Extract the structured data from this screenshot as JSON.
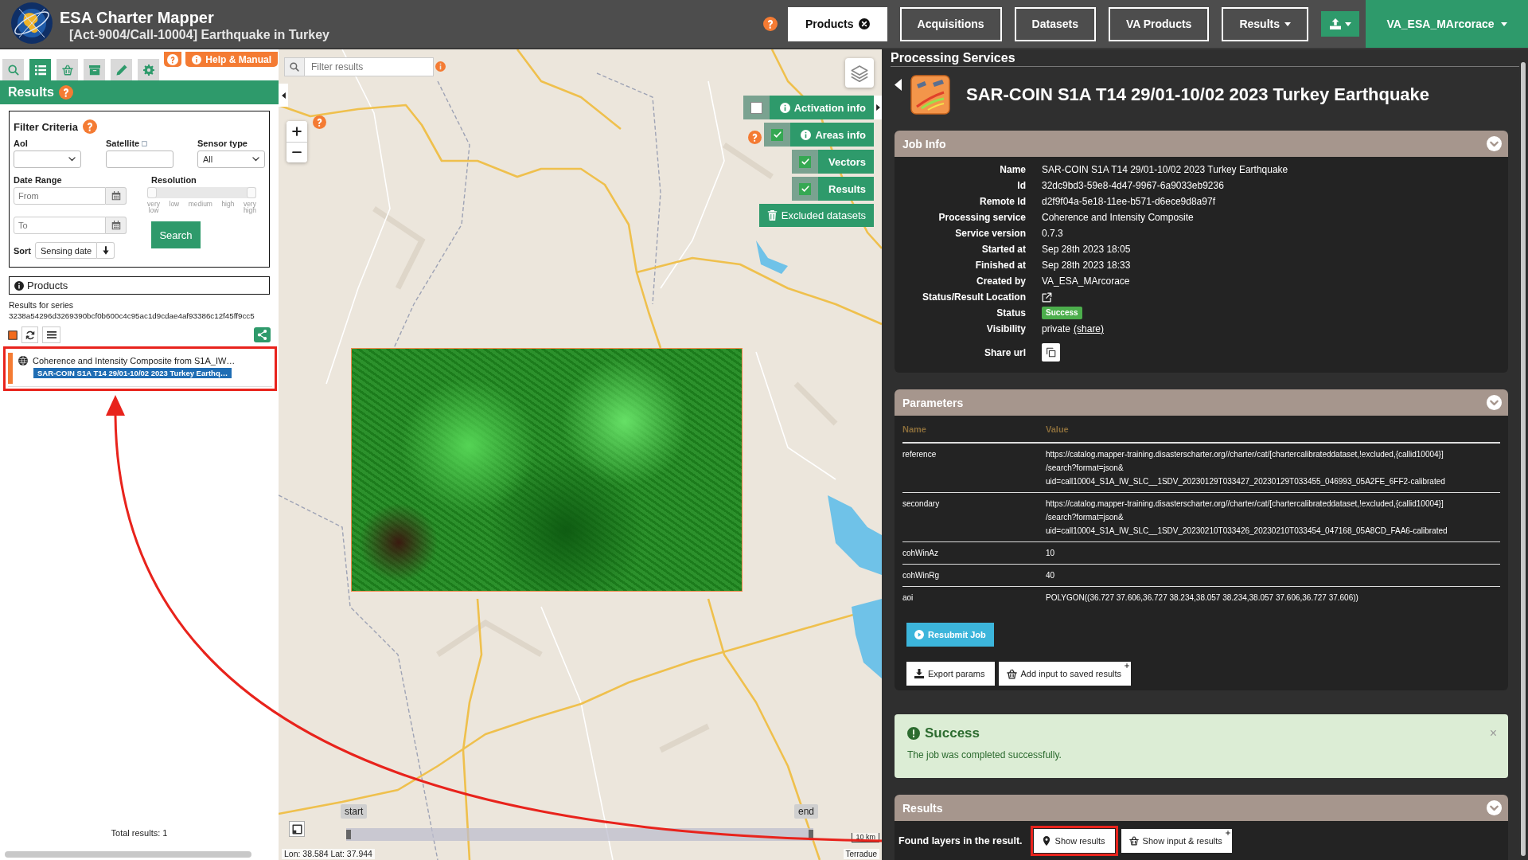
{
  "header": {
    "title": "ESA Charter Mapper",
    "subtitle": "[Act-9004/Call-10004] Earthquake in Turkey",
    "nav": [
      {
        "label": "Products",
        "kind": "closable",
        "selected": true
      },
      {
        "label": "Acquisitions",
        "kind": "plain",
        "selected": false
      },
      {
        "label": "Datasets",
        "kind": "plain",
        "selected": false
      },
      {
        "label": "VA Products",
        "kind": "plain",
        "selected": false
      },
      {
        "label": "Results",
        "kind": "dropdown",
        "selected": false
      }
    ],
    "user": "VA_ESA_MArcorace"
  },
  "sidebar": {
    "tabs": [
      {
        "kind": "search",
        "selected": false
      },
      {
        "kind": "list",
        "selected": true
      },
      {
        "kind": "basket",
        "selected": false
      },
      {
        "kind": "archive",
        "selected": false
      },
      {
        "kind": "pencil",
        "selected": false
      },
      {
        "kind": "gear",
        "selected": false
      }
    ],
    "help_button": "Help & Manual",
    "title": "Results",
    "filter": {
      "title": "Filter Criteria",
      "aoi": {
        "label": "AoI"
      },
      "satellite": {
        "label": "Satellite"
      },
      "sensor_type": {
        "label": "Sensor type",
        "value": "All"
      },
      "date_range": {
        "label": "Date Range",
        "from": {
          "placeholder": "From"
        },
        "to": {
          "placeholder": "To"
        }
      },
      "resolution": {
        "label": "Resolution",
        "level": 1,
        "ticks": [
          "very low",
          "low",
          "medium",
          "high",
          "very high"
        ]
      },
      "search_button": "Search",
      "sort": {
        "label": "Sort",
        "value": "Sensing date"
      }
    },
    "products_title": "Products",
    "series_label": "Results for series",
    "series_id": "3238a54296d3269390bcf0b600c4c95ac1d9cdae4af93386c12f45ff9cc5",
    "results": [
      {
        "title": "Coherence and Intensity Composite from S1A_IW…",
        "tag": "SAR-COIN S1A T14 29/01-10/02 2023 Turkey Earthq…",
        "highlighted": true
      }
    ],
    "total": "Total results: 1"
  },
  "map": {
    "filter": {
      "placeholder": "Filter results"
    },
    "layers": [
      {
        "label": "Activation info",
        "kind": "info",
        "checked": false
      },
      {
        "label": "Areas info",
        "kind": "info",
        "checked": true
      },
      {
        "label": "Vectors",
        "kind": "plain",
        "checked": true
      },
      {
        "label": "Results",
        "kind": "plain",
        "checked": true
      }
    ],
    "excluded_button": "Excluded datasets",
    "timeline": {
      "start": "start",
      "end": "end"
    },
    "scale": "10 km",
    "coordinates": "Lon: 38.584 Lat: 37.944",
    "attribution": "Terradue"
  },
  "processing": {
    "heading": "Processing Services",
    "title": "SAR-COIN S1A T14 29/01-10/02 2023 Turkey Earthquake",
    "job_info": {
      "title": "Job Info",
      "fields": [
        {
          "label": "Name",
          "kind": "text",
          "value": "SAR-COIN S1A T14 29/01-10/02 2023 Turkey Earthquake"
        },
        {
          "label": "Id",
          "kind": "text",
          "value": "32dc9bd3-59e8-4d47-9967-6a9033eb9236"
        },
        {
          "label": "Remote Id",
          "kind": "text",
          "value": "d2f9f04a-5e18-11ee-b571-d6ece9d8a97f"
        },
        {
          "label": "Processing service",
          "kind": "text",
          "value": "Coherence and Intensity Composite"
        },
        {
          "label": "Service version",
          "kind": "text",
          "value": "0.7.3"
        },
        {
          "label": "Started at",
          "kind": "text",
          "value": "Sep 28th 2023 18:05"
        },
        {
          "label": "Finished at",
          "kind": "text",
          "value": "Sep 28th 2023 18:33"
        },
        {
          "label": "Created by",
          "kind": "text",
          "value": "VA_ESA_MArcorace"
        },
        {
          "label": "Status/Result Location",
          "kind": "link"
        },
        {
          "label": "Status",
          "kind": "badge",
          "value": "Success"
        },
        {
          "label": "Visibility",
          "kind": "visibility",
          "value": "private",
          "link": "(share)"
        },
        {
          "label": "Share url",
          "kind": "copy"
        }
      ]
    },
    "parameters": {
      "title": "Parameters",
      "columns": [
        "Name",
        "Value"
      ],
      "rows": [
        {
          "name": "reference",
          "value": [
            "https://catalog.mapper-training.disasterscharter.org//charter/cat/[chartercalibrateddataset,!excluded,{callid10004}]",
            "/search?format=json&",
            "uid=call10004_S1A_IW_SLC__1SDV_20230129T033427_20230129T033455_046993_05A2FE_6FF2-calibrated"
          ]
        },
        {
          "name": "secondary",
          "value": [
            "https://catalog.mapper-training.disasterscharter.org//charter/cat/[chartercalibrateddataset,!excluded,{callid10004}]",
            "/search?format=json&",
            "uid=call10004_S1A_IW_SLC__1SDV_20230210T033426_20230210T033454_047168_05A8CD_FAA6-calibrated"
          ]
        },
        {
          "name": "cohWinAz",
          "value": [
            "10"
          ]
        },
        {
          "name": "cohWinRg",
          "value": [
            "40"
          ]
        },
        {
          "name": "aoi",
          "value": [
            "POLYGON((36.727 37.606,36.727 38.234,38.057 38.234,38.057 37.606,36.727 37.606))"
          ]
        }
      ],
      "resubmit_button": "Resubmit Job",
      "export_button": "Export params",
      "save_button": "Add input to saved results"
    },
    "alert": {
      "title": "Success",
      "message": "The job was completed successfully.",
      "close": "×"
    },
    "results": {
      "title": "Results",
      "message": "Found layers in the result.",
      "buttons": [
        {
          "label": "Show results",
          "kind": "marker",
          "highlighted": true
        },
        {
          "label": "Show input & results",
          "kind": "basket",
          "highlighted": false
        }
      ]
    }
  }
}
